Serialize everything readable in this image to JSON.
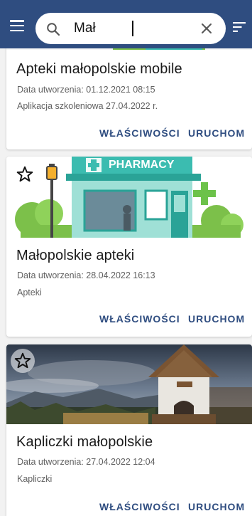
{
  "search": {
    "query": "Mał"
  },
  "icons": {
    "menu": "menu-icon",
    "search": "search-icon",
    "clear": "close-icon",
    "filter": "filter-icon",
    "star": "star-outline-icon"
  },
  "colors": {
    "appbar": "#2f4d80",
    "action": "#2f4d80",
    "background": "#f2f2f2"
  },
  "cards": [
    {
      "title": "Apteki małopolskie mobile",
      "created": "Data utworzenia: 01.12.2021 08:15",
      "description": "Aplikacja szkoleniowa 27.04.2022 r.",
      "properties_label": "WŁAŚCIWOŚCI",
      "launch_label": "URUCHOM"
    },
    {
      "banner_text": "PHARMACY",
      "title": "Małopolskie apteki",
      "created": "Data utworzenia: 28.04.2022 16:13",
      "description": "Apteki",
      "properties_label": "WŁAŚCIWOŚCI",
      "launch_label": "URUCHOM"
    },
    {
      "title": "Kapliczki małopolskie",
      "created": "Data utworzenia: 27.04.2022 12:04",
      "description": "Kapliczki",
      "properties_label": "WŁAŚCIWOŚCI",
      "launch_label": "URUCHOM"
    }
  ]
}
